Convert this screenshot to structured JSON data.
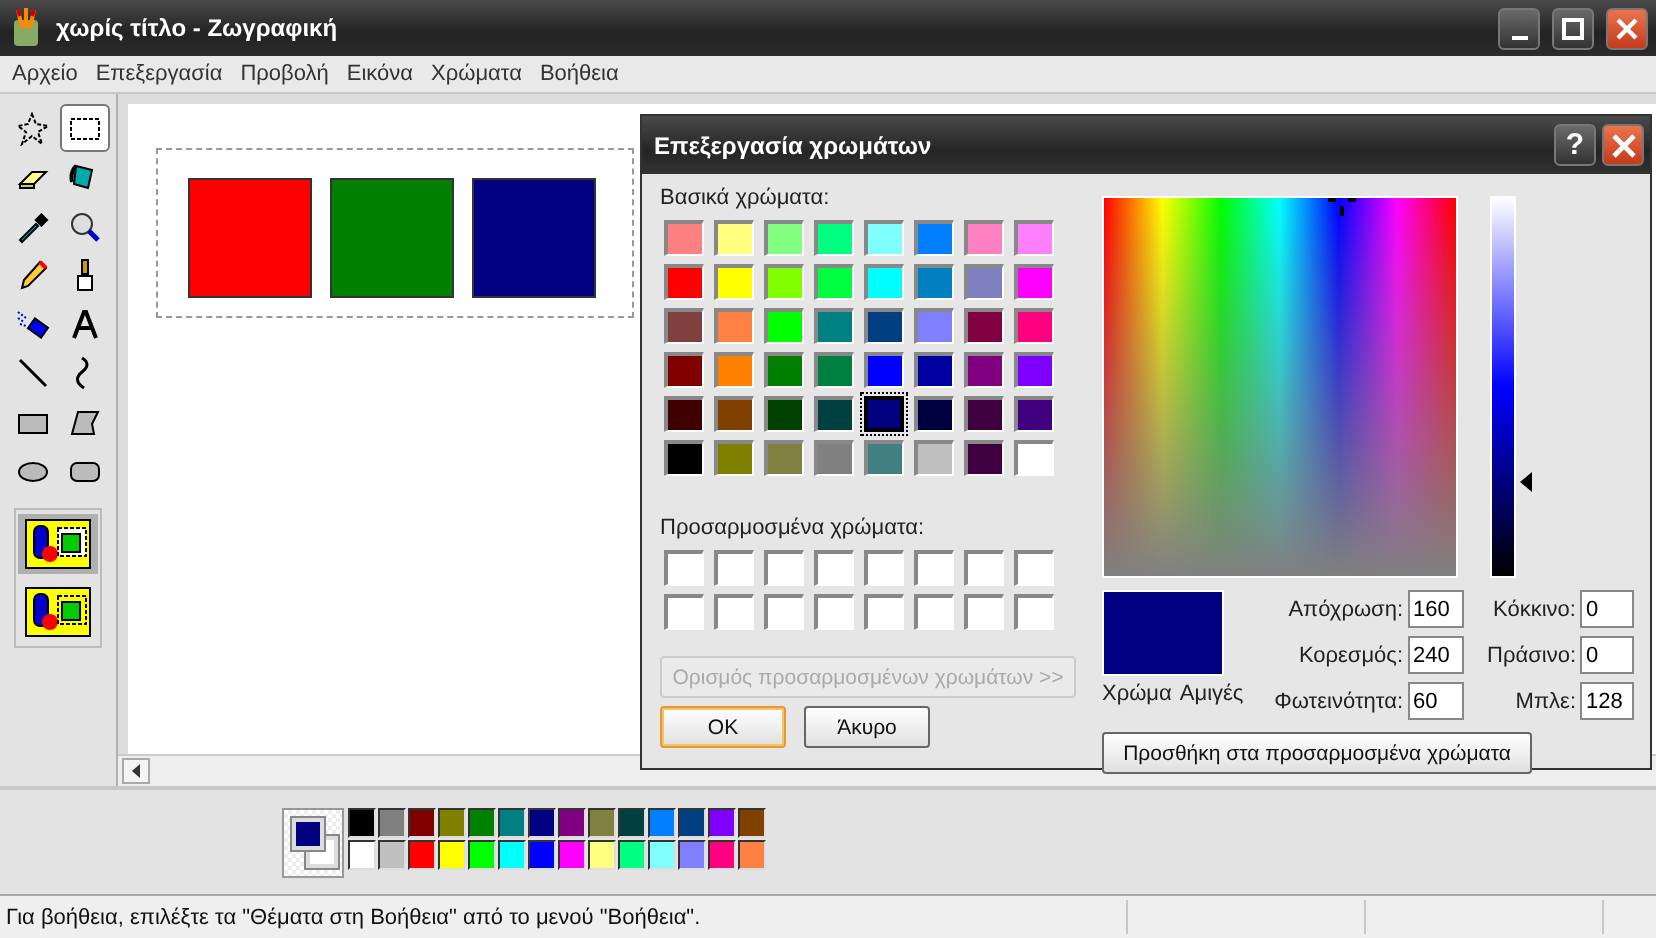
{
  "window": {
    "title": "χωρίς τίτλο - Ζωγραφική"
  },
  "menu": [
    "Αρχείο",
    "Επεξεργασία",
    "Προβολή",
    "Εικόνα",
    "Χρώματα",
    "Βοήθεια"
  ],
  "tools": [
    {
      "kind": "freeselect",
      "selected": false
    },
    {
      "kind": "select",
      "selected": true
    },
    {
      "kind": "eraser",
      "selected": false
    },
    {
      "kind": "fill",
      "selected": false
    },
    {
      "kind": "picker",
      "selected": false
    },
    {
      "kind": "magnifier",
      "selected": false
    },
    {
      "kind": "pencil",
      "selected": false
    },
    {
      "kind": "brush",
      "selected": false
    },
    {
      "kind": "airbrush",
      "selected": false
    },
    {
      "kind": "text",
      "selected": false
    },
    {
      "kind": "line",
      "selected": false
    },
    {
      "kind": "curve",
      "selected": false
    },
    {
      "kind": "rectangle",
      "selected": false
    },
    {
      "kind": "polygon",
      "selected": false
    },
    {
      "kind": "ellipse",
      "selected": false
    },
    {
      "kind": "roundrect",
      "selected": false
    }
  ],
  "tool_options": [
    {
      "kind": "opaque",
      "selected": true
    },
    {
      "kind": "transparent",
      "selected": false
    }
  ],
  "canvas": {
    "shapes": [
      {
        "color": "#ff0000"
      },
      {
        "color": "#008000"
      },
      {
        "color": "#000080"
      }
    ]
  },
  "palette": {
    "foreground": {
      "color": "#000080"
    },
    "background": {
      "color": "#ffffff"
    },
    "colors": [
      {
        "color": "#000000"
      },
      {
        "color": "#808080"
      },
      {
        "color": "#800000"
      },
      {
        "color": "#808000"
      },
      {
        "color": "#008000"
      },
      {
        "color": "#008080"
      },
      {
        "color": "#000080"
      },
      {
        "color": "#800080"
      },
      {
        "color": "#808040"
      },
      {
        "color": "#004040"
      },
      {
        "color": "#0080ff"
      },
      {
        "color": "#004080"
      },
      {
        "color": "#8000ff"
      },
      {
        "color": "#804000"
      },
      {
        "color": "#ffffff"
      },
      {
        "color": "#c0c0c0"
      },
      {
        "color": "#ff0000"
      },
      {
        "color": "#ffff00"
      },
      {
        "color": "#00ff00"
      },
      {
        "color": "#00ffff"
      },
      {
        "color": "#0000ff"
      },
      {
        "color": "#ff00ff"
      },
      {
        "color": "#ffff80"
      },
      {
        "color": "#00ff80"
      },
      {
        "color": "#80ffff"
      },
      {
        "color": "#8080ff"
      },
      {
        "color": "#ff0080"
      },
      {
        "color": "#ff8040"
      }
    ]
  },
  "status_bar": {
    "text": "Για βοήθεια, επιλέξτε τα \"Θέματα στη Βοήθεια\" από το μενού \"Βοήθεια\"."
  },
  "dialog": {
    "title": "Επεξεργασία χρωμάτων",
    "help_button": "?",
    "basic_label": "Βασικά χρώματα:",
    "basic_colors": [
      {
        "color": "#ff8080",
        "selected": false
      },
      {
        "color": "#ffff80",
        "selected": false
      },
      {
        "color": "#80ff80",
        "selected": false
      },
      {
        "color": "#00ff80",
        "selected": false
      },
      {
        "color": "#80ffff",
        "selected": false
      },
      {
        "color": "#0080ff",
        "selected": false
      },
      {
        "color": "#ff80c0",
        "selected": false
      },
      {
        "color": "#ff80ff",
        "selected": false
      },
      {
        "color": "#ff0000",
        "selected": false
      },
      {
        "color": "#ffff00",
        "selected": false
      },
      {
        "color": "#80ff00",
        "selected": false
      },
      {
        "color": "#00ff40",
        "selected": false
      },
      {
        "color": "#00ffff",
        "selected": false
      },
      {
        "color": "#0080c0",
        "selected": false
      },
      {
        "color": "#8080c0",
        "selected": false
      },
      {
        "color": "#ff00ff",
        "selected": false
      },
      {
        "color": "#804040",
        "selected": false
      },
      {
        "color": "#ff8040",
        "selected": false
      },
      {
        "color": "#00ff00",
        "selected": false
      },
      {
        "color": "#008080",
        "selected": false
      },
      {
        "color": "#004080",
        "selected": false
      },
      {
        "color": "#8080ff",
        "selected": false
      },
      {
        "color": "#800040",
        "selected": false
      },
      {
        "color": "#ff0080",
        "selected": false
      },
      {
        "color": "#800000",
        "selected": false
      },
      {
        "color": "#ff8000",
        "selected": false
      },
      {
        "color": "#008000",
        "selected": false
      },
      {
        "color": "#008040",
        "selected": false
      },
      {
        "color": "#0000ff",
        "selected": false
      },
      {
        "color": "#0000a0",
        "selected": false
      },
      {
        "color": "#800080",
        "selected": false
      },
      {
        "color": "#8000ff",
        "selected": false
      },
      {
        "color": "#400000",
        "selected": false
      },
      {
        "color": "#804000",
        "selected": false
      },
      {
        "color": "#004000",
        "selected": false
      },
      {
        "color": "#004040",
        "selected": false
      },
      {
        "color": "#000080",
        "selected": true
      },
      {
        "color": "#000040",
        "selected": false
      },
      {
        "color": "#400040",
        "selected": false
      },
      {
        "color": "#400080",
        "selected": false
      },
      {
        "color": "#000000",
        "selected": false
      },
      {
        "color": "#808000",
        "selected": false
      },
      {
        "color": "#808040",
        "selected": false
      },
      {
        "color": "#808080",
        "selected": false
      },
      {
        "color": "#408080",
        "selected": false
      },
      {
        "color": "#c0c0c0",
        "selected": false
      },
      {
        "color": "#400040",
        "selected": false
      },
      {
        "color": "#ffffff",
        "selected": false
      }
    ],
    "custom_label": "Προσαρμοσμένα χρώματα:",
    "custom_colors": [
      {
        "color": "#ffffff"
      },
      {
        "color": "#ffffff"
      },
      {
        "color": "#ffffff"
      },
      {
        "color": "#ffffff"
      },
      {
        "color": "#ffffff"
      },
      {
        "color": "#ffffff"
      },
      {
        "color": "#ffffff"
      },
      {
        "color": "#ffffff"
      },
      {
        "color": "#ffffff"
      },
      {
        "color": "#ffffff"
      },
      {
        "color": "#ffffff"
      },
      {
        "color": "#ffffff"
      },
      {
        "color": "#ffffff"
      },
      {
        "color": "#ffffff"
      },
      {
        "color": "#ffffff"
      },
      {
        "color": "#ffffff"
      }
    ],
    "define_button": {
      "label": "Ορισμός προσαρμοσμένων χρωμάτων >>",
      "disabled": true
    },
    "ok_button": "OK",
    "cancel_button": "Άκυρο",
    "luminance": {
      "level": 0.25
    },
    "preview": {
      "color": "#000080",
      "labels": [
        "Χρώμα",
        "Αμιγές"
      ]
    },
    "hsl_fields": [
      {
        "label": "Απόχρωση:",
        "value": "160"
      },
      {
        "label": "Κορεσμός:",
        "value": "240"
      },
      {
        "label": "Φωτεινότητα:",
        "value": "60"
      }
    ],
    "rgb_fields": [
      {
        "label": "Κόκκινο:",
        "value": "0"
      },
      {
        "label": "Πράσινο:",
        "value": "0"
      },
      {
        "label": "Μπλε:",
        "value": "128"
      }
    ],
    "add_button": "Προσθήκη στα προσαρμοσμένα χρώματα"
  }
}
